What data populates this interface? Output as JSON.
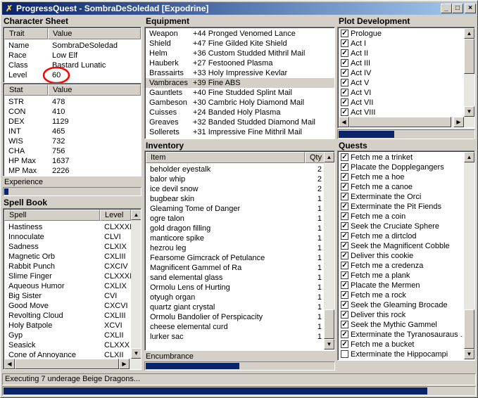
{
  "window": {
    "title": "ProgressQuest - SombraDeSoledad [Expodrine]",
    "status": "Executing 7 underage Beige Dragons..."
  },
  "character": {
    "section_title": "Character Sheet",
    "col_trait": "Trait",
    "col_value": "Value",
    "traits": [
      {
        "name": "Name",
        "value": "SombraDeSoledad"
      },
      {
        "name": "Race",
        "value": "Low Elf"
      },
      {
        "name": "Class",
        "value": "Bastard Lunatic"
      },
      {
        "name": "Level",
        "value": "60"
      }
    ],
    "col_stat": "Stat",
    "col_stat_value": "Value",
    "stats": [
      {
        "name": "STR",
        "value": "478"
      },
      {
        "name": "CON",
        "value": "410"
      },
      {
        "name": "DEX",
        "value": "1129"
      },
      {
        "name": "INT",
        "value": "465"
      },
      {
        "name": "WIS",
        "value": "732"
      },
      {
        "name": "CHA",
        "value": "756"
      },
      {
        "name": "HP Max",
        "value": "1637"
      },
      {
        "name": "MP Max",
        "value": "2226"
      }
    ],
    "experience_label": "Experience",
    "experience_progress": 0.04
  },
  "spellbook": {
    "section_title": "Spell Book",
    "col_spell": "Spell",
    "col_level": "Level",
    "spells": [
      {
        "name": "Hastiness",
        "level": "CLXXXI"
      },
      {
        "name": "Innoculate",
        "level": "CLVI"
      },
      {
        "name": "Sadness",
        "level": "CLXIX"
      },
      {
        "name": "Magnetic Orb",
        "level": "CXLIII"
      },
      {
        "name": "Rabbit Punch",
        "level": "CXCIV"
      },
      {
        "name": "Slime Finger",
        "level": "CLXXXIV"
      },
      {
        "name": "Aqueous Humor",
        "level": "CXLIX"
      },
      {
        "name": "Big Sister",
        "level": "CVI"
      },
      {
        "name": "Good Move",
        "level": "CXCVI"
      },
      {
        "name": "Revolting Cloud",
        "level": "CXLIII"
      },
      {
        "name": "Holy Batpole",
        "level": "XCVI"
      },
      {
        "name": "Gyp",
        "level": "CXLII"
      },
      {
        "name": "Seasick",
        "level": "CLXXX"
      },
      {
        "name": "Cone of Annoyance",
        "level": "CLXII"
      }
    ]
  },
  "equipment": {
    "section_title": "Equipment",
    "items": [
      {
        "slot": "Weapon",
        "item": "+44 Pronged Venomed Lance"
      },
      {
        "slot": "Shield",
        "item": "+47 Fine Gilded Kite Shield"
      },
      {
        "slot": "Helm",
        "item": "+36 Custom Studded Mithril Mail"
      },
      {
        "slot": "Hauberk",
        "item": "+27 Festooned Plasma"
      },
      {
        "slot": "Brassairts",
        "item": "+33 Holy Impressive Kevlar"
      },
      {
        "slot": "Vambraces",
        "item": "+39 Fine ABS"
      },
      {
        "slot": "Gauntlets",
        "item": "+40 Fine Studded Splint Mail"
      },
      {
        "slot": "Gambeson",
        "item": "+30 Cambric Holy Diamond Mail"
      },
      {
        "slot": "Cuisses",
        "item": "+24 Banded Holy Plasma"
      },
      {
        "slot": "Greaves",
        "item": "+32 Banded Studded Diamond Mail"
      },
      {
        "slot": "Sollerets",
        "item": "+31 Impressive Fine Mithril Mail"
      }
    ]
  },
  "inventory": {
    "section_title": "Inventory",
    "col_item": "Item",
    "col_qty": "Qty",
    "items": [
      {
        "name": "beholder eyestalk",
        "qty": "2"
      },
      {
        "name": "balor whip",
        "qty": "2"
      },
      {
        "name": "ice devil snow",
        "qty": "2"
      },
      {
        "name": "bugbear skin",
        "qty": "1"
      },
      {
        "name": "Gleaming Tome of Danger",
        "qty": "1"
      },
      {
        "name": "ogre talon",
        "qty": "1"
      },
      {
        "name": "gold dragon filling",
        "qty": "1"
      },
      {
        "name": "manticore spike",
        "qty": "1"
      },
      {
        "name": "hezrou leg",
        "qty": "1"
      },
      {
        "name": "Fearsome Gimcrack of Petulance",
        "qty": "1"
      },
      {
        "name": "Magnificent Gammel of Ra",
        "qty": "1"
      },
      {
        "name": "sand elemental glass",
        "qty": "1"
      },
      {
        "name": "Ormolu Lens of Hurting",
        "qty": "1"
      },
      {
        "name": "otyugh organ",
        "qty": "1"
      },
      {
        "name": "quartz giant crystal",
        "qty": "1"
      },
      {
        "name": "Ormolu Bandolier of Perspicacity",
        "qty": "1"
      },
      {
        "name": "cheese elemental curd",
        "qty": "1"
      },
      {
        "name": "lurker sac",
        "qty": "1"
      }
    ],
    "encumbrance_label": "Encumbrance",
    "encumbrance_progress": 0.5
  },
  "plot": {
    "section_title": "Plot Development",
    "acts": [
      "Prologue",
      "Act I",
      "Act II",
      "Act III",
      "Act IV",
      "Act V",
      "Act VI",
      "Act VII",
      "Act VIII"
    ],
    "progress": 0.42
  },
  "quests": {
    "section_title": "Quests",
    "items": [
      {
        "label": "Fetch me a trinket",
        "done": true
      },
      {
        "label": "Placate the Dopplegangers",
        "done": true
      },
      {
        "label": "Fetch me a hoe",
        "done": true
      },
      {
        "label": "Fetch me a canoe",
        "done": true
      },
      {
        "label": "Exterminate the Orci",
        "done": true
      },
      {
        "label": "Exterminate the Pit Fiends",
        "done": true
      },
      {
        "label": "Fetch me a coin",
        "done": true
      },
      {
        "label": "Seek the Cruciate Sphere",
        "done": true
      },
      {
        "label": "Fetch me a dirtclod",
        "done": true
      },
      {
        "label": "Seek the Magnificent Cobble",
        "done": true
      },
      {
        "label": "Deliver this cookie",
        "done": true
      },
      {
        "label": "Fetch me a credenza",
        "done": true
      },
      {
        "label": "Fetch me a plank",
        "done": true
      },
      {
        "label": "Placate the Mermen",
        "done": true
      },
      {
        "label": "Fetch me a rock",
        "done": true
      },
      {
        "label": "Seek the Gleaming Brocade",
        "done": true
      },
      {
        "label": "Deliver this rock",
        "done": true
      },
      {
        "label": "Seek the Mythic Gammel",
        "done": true
      },
      {
        "label": "Exterminate the Tyranosauraus ...",
        "done": true
      },
      {
        "label": "Fetch me a bucket",
        "done": true
      },
      {
        "label": "Exterminate the Hippocampi",
        "done": false
      }
    ]
  },
  "task_progress": 0.9,
  "icons": {
    "app": "pq-logo-icon",
    "check": "checkmark-icon"
  },
  "colors": {
    "title_start": "#0a246a",
    "title_end": "#a6caf0",
    "progress_fill": "#0a246a",
    "highlight": "#ff0000"
  }
}
